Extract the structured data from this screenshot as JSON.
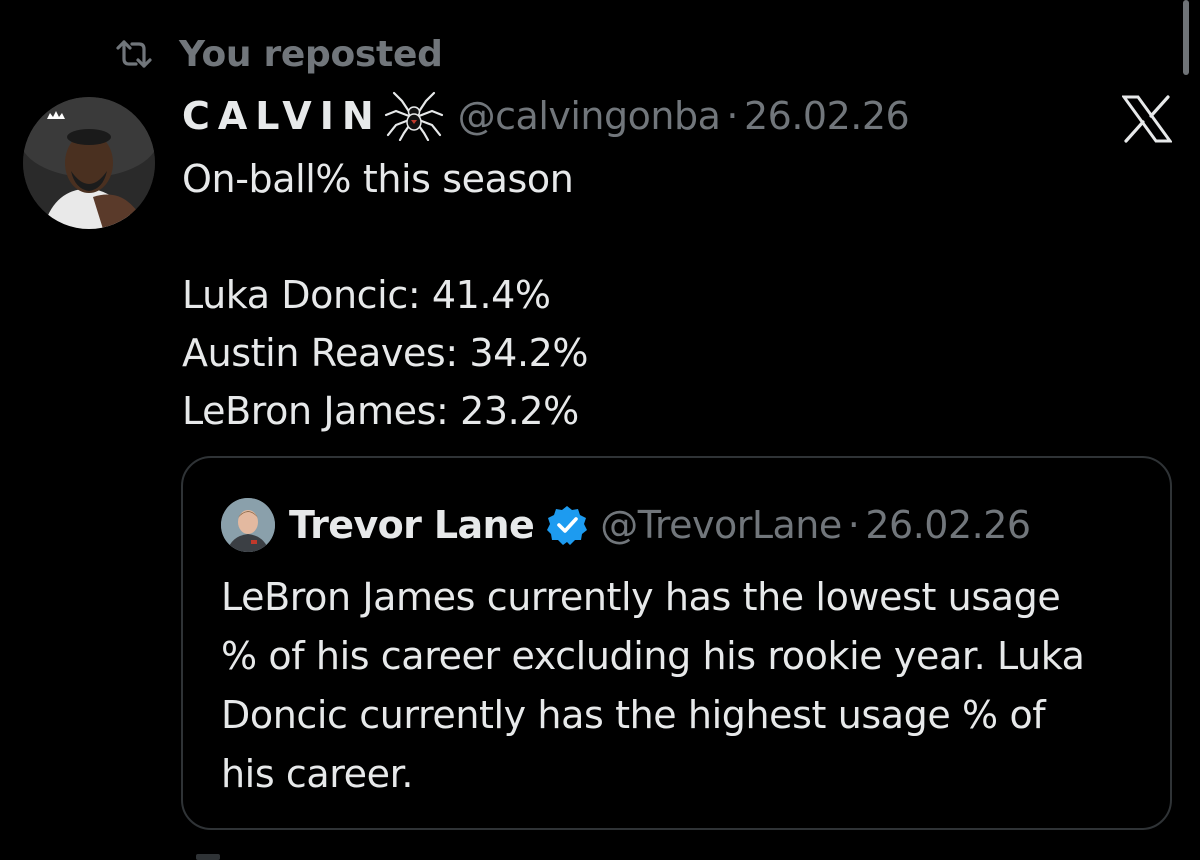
{
  "repost": {
    "label": "You reposted",
    "icon": "repost-icon"
  },
  "tweet": {
    "display_name": "CALVIN",
    "name_emoji": "spider-icon",
    "handle": "@calvingonba",
    "separator": "·",
    "date": "26.02.26",
    "lines": [
      "On-ball% this season",
      "",
      "Luka Doncic: 41.4%",
      "Austin Reaves: 34.2%",
      "LeBron James: 23.2%"
    ]
  },
  "quote": {
    "display_name": "Trevor Lane",
    "verified": true,
    "handle": "@TrevorLane",
    "separator": "·",
    "date": "26.02.26",
    "lines": [
      "LeBron James currently has the lowest usage",
      "% of his career excluding his rookie year. Luka",
      "Doncic currently has the highest usage % of",
      "his career."
    ]
  },
  "colors": {
    "background": "#000000",
    "text_primary": "#e7e9ea",
    "text_secondary": "#71767b",
    "border": "#2f3336",
    "verified": "#1d9bf0"
  }
}
